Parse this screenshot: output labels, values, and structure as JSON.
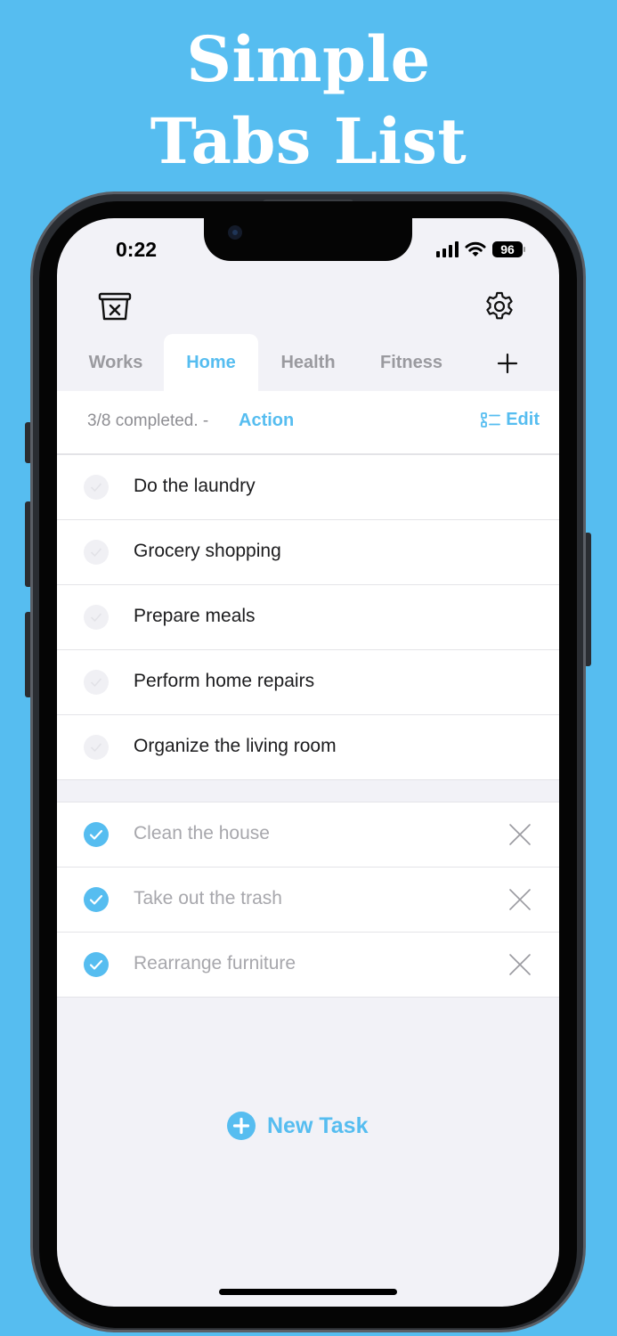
{
  "promo": {
    "line1": "Simple",
    "line2": "Tabs List",
    "background": "#56bdf0"
  },
  "status_bar": {
    "time": "0:22",
    "battery": "96",
    "icons": [
      "signal-icon",
      "wifi-icon",
      "battery-icon"
    ]
  },
  "toolbar": {
    "left_icon": "trash-bin-icon",
    "right_icon": "gear-icon"
  },
  "tabs": [
    {
      "label": "Works",
      "active": false
    },
    {
      "label": "Home",
      "active": true
    },
    {
      "label": "Health",
      "active": false
    },
    {
      "label": "Fitness",
      "active": false
    }
  ],
  "add_tab_label": "+",
  "summary": {
    "completed_text": "3/8 completed. -",
    "action_label": "Action",
    "edit_label": "Edit"
  },
  "active_tasks": [
    {
      "title": "Do the laundry",
      "done": false
    },
    {
      "title": "Grocery shopping",
      "done": false
    },
    {
      "title": "Prepare meals",
      "done": false
    },
    {
      "title": "Perform home repairs",
      "done": false
    },
    {
      "title": "Organize the living room",
      "done": false
    }
  ],
  "completed_tasks": [
    {
      "title": "Clean the house",
      "done": true
    },
    {
      "title": "Take out the trash",
      "done": true
    },
    {
      "title": "Rearrange furniture",
      "done": true
    }
  ],
  "new_task_label": "New Task",
  "colors": {
    "accent": "#56bdf0",
    "screen_bg": "#f2f2f7",
    "muted_text": "#8e8e93"
  }
}
